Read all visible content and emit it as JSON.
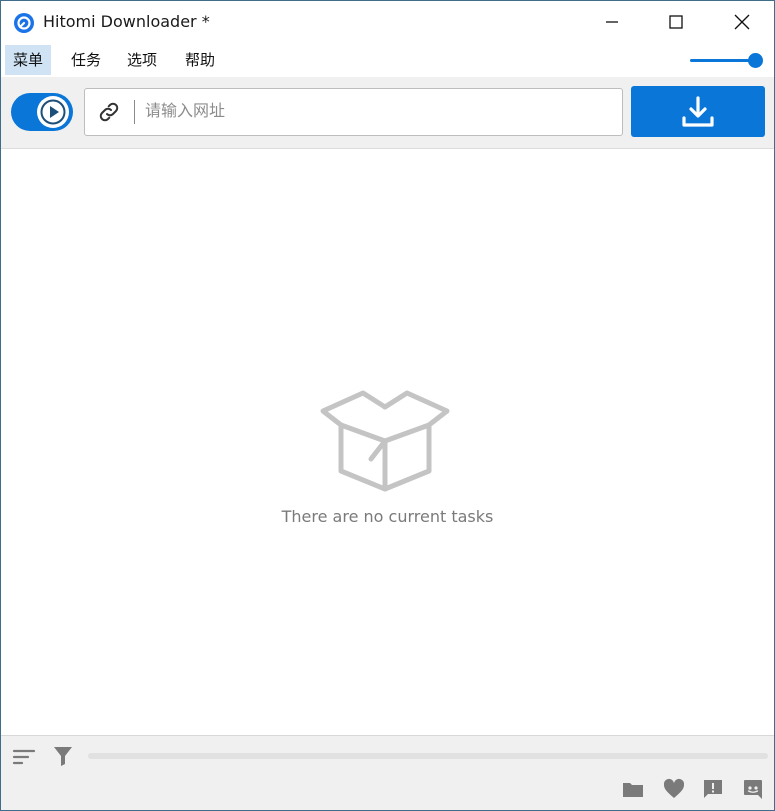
{
  "window": {
    "title": "Hitomi Downloader *"
  },
  "menu": {
    "items": [
      "菜单",
      "任务",
      "选项",
      "帮助"
    ],
    "active_index": 0
  },
  "toolbar": {
    "url_placeholder": "请输入网址",
    "url_value": ""
  },
  "content": {
    "empty_message": "There are no current tasks"
  },
  "footer": {
    "progress": 0
  },
  "slider": {
    "value": 1.0
  },
  "colors": {
    "accent": "#0a76d8",
    "menu_active": "#cfe3f5",
    "toolbar_bg": "#f0f0f0",
    "muted_icon": "#c4c4c4",
    "text_muted": "#7a7a7a"
  },
  "icons": [
    "app-logo-icon",
    "minimize-icon",
    "maximize-icon",
    "close-icon",
    "play-icon",
    "link-icon",
    "download-icon",
    "empty-box-icon",
    "sort-icon",
    "filter-icon",
    "folder-icon",
    "heart-icon",
    "feedback-icon",
    "discord-icon"
  ]
}
